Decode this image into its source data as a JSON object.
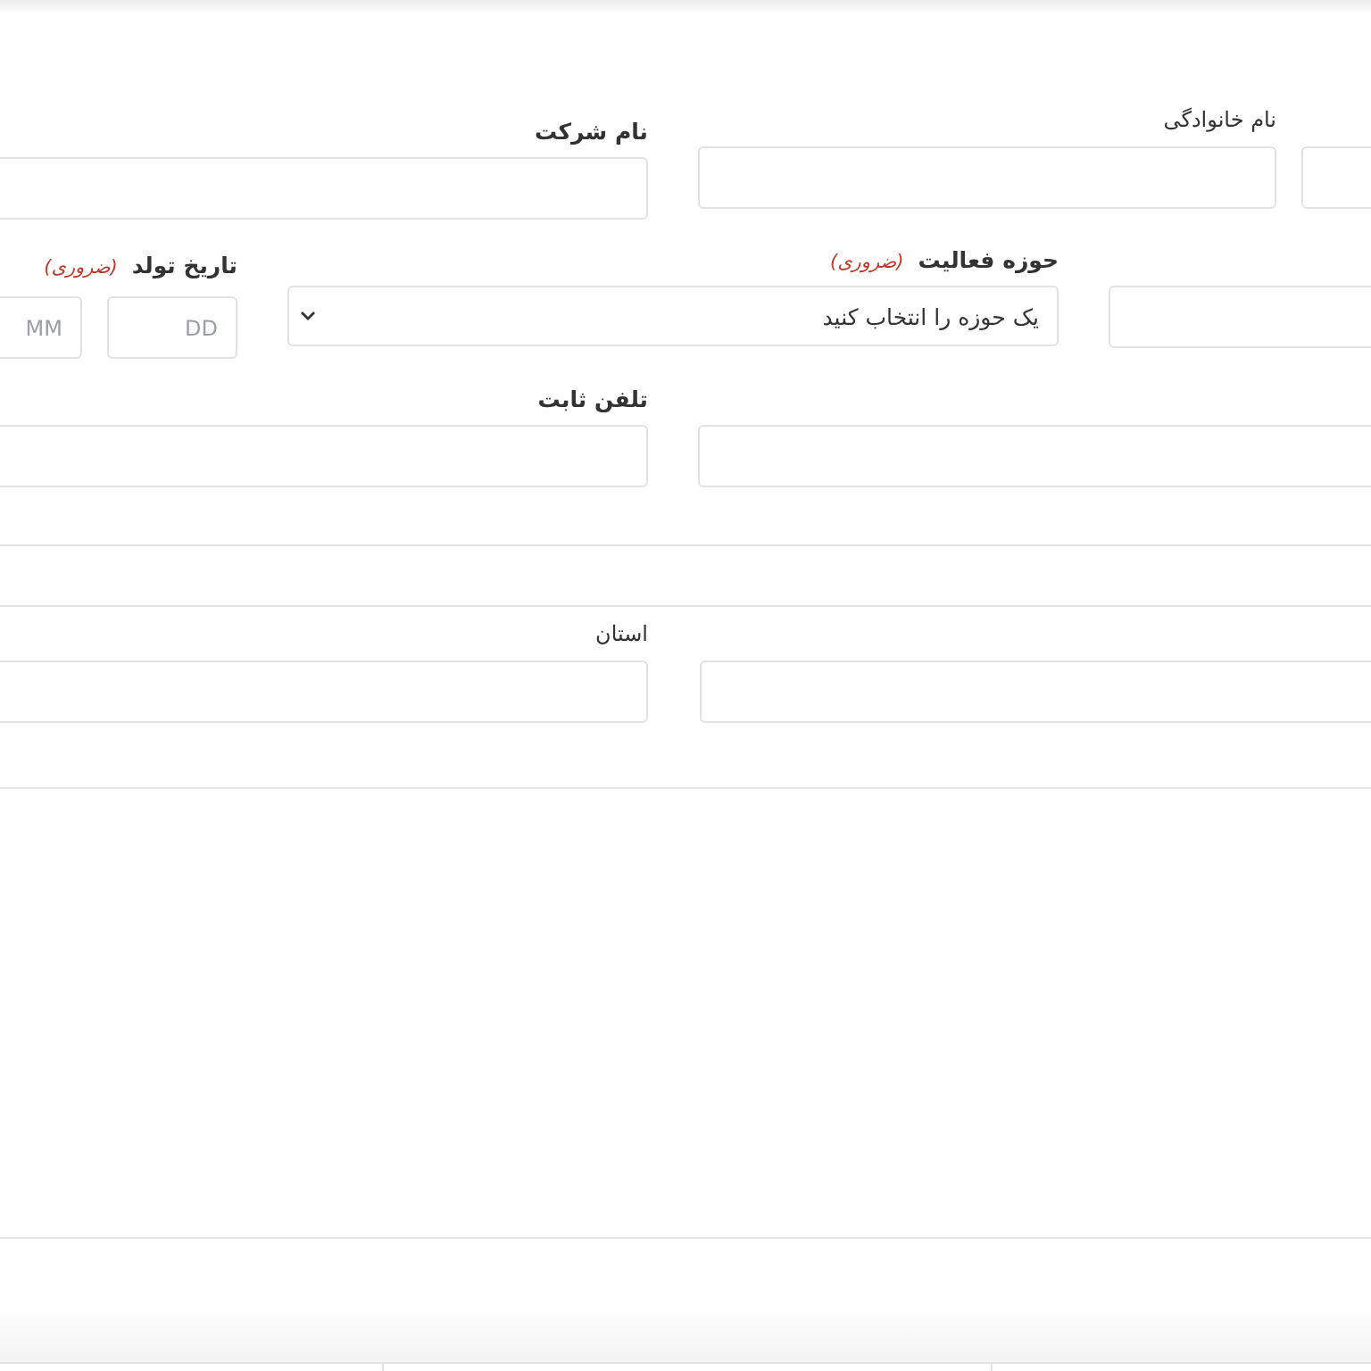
{
  "form": {
    "rows": [
      {
        "fields": [
          {
            "kind": "input"
          },
          {
            "kind": "input",
            "label": "نام خانوادگی",
            "bold": false
          },
          {
            "kind": "input",
            "label": "نام شرکت",
            "bold": true
          }
        ]
      },
      {
        "fields": [
          {
            "kind": "input"
          },
          {
            "kind": "select",
            "label": "حوزه فعالیت",
            "bold": true,
            "required_note": "(ضروری)",
            "value": "یک حوزه را انتخاب کنید"
          },
          {
            "kind": "date",
            "label": "تاریخ تولد",
            "bold": true,
            "required_note": "(ضروری)",
            "parts": [
              {
                "placeholder": "DD"
              },
              {
                "placeholder": "MM"
              }
            ]
          }
        ]
      },
      {
        "fields": [
          {
            "kind": "input"
          },
          {
            "kind": "input",
            "label": "تلفن ثابت",
            "bold": true
          }
        ]
      },
      {
        "fields": [
          {
            "kind": "input"
          }
        ]
      },
      {
        "fields": [
          {
            "kind": "input"
          },
          {
            "kind": "input",
            "label": "استان",
            "bold": false
          }
        ]
      }
    ]
  }
}
